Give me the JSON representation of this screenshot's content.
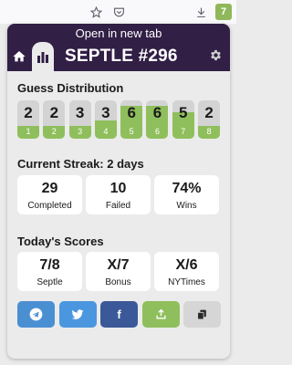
{
  "browser_toolbar": {
    "icons": [
      "star-icon",
      "pocket-icon",
      "download-icon",
      "septle-extension-icon"
    ],
    "extension_badge": "7",
    "extension_color": "#8fb85a"
  },
  "header": {
    "open_link": "Open in new tab",
    "title": "SEPTLE #296",
    "background": "#311f45"
  },
  "guess_distribution": {
    "title": "Guess Distribution",
    "bars": [
      {
        "guess": "1",
        "count": "2",
        "fill": 0.34
      },
      {
        "guess": "2",
        "count": "2",
        "fill": 0.34
      },
      {
        "guess": "3",
        "count": "3",
        "fill": 0.34
      },
      {
        "guess": "4",
        "count": "3",
        "fill": 0.48
      },
      {
        "guess": "5",
        "count": "6",
        "fill": 0.85
      },
      {
        "guess": "6",
        "count": "6",
        "fill": 0.85
      },
      {
        "guess": "7",
        "count": "5",
        "fill": 0.68
      },
      {
        "guess": "8",
        "count": "2",
        "fill": 0.34
      }
    ],
    "fill_color": "#8fbf5c",
    "empty_color": "#d3d3d3"
  },
  "streak": {
    "title": "Current Streak: 2 days",
    "stats": [
      {
        "value": "29",
        "label": "Completed"
      },
      {
        "value": "10",
        "label": "Failed"
      },
      {
        "value": "74%",
        "label": "Wins"
      }
    ]
  },
  "scores": {
    "title": "Today's Scores",
    "items": [
      {
        "value": "7/8",
        "label": "Septle"
      },
      {
        "value": "X/7",
        "label": "Bonus"
      },
      {
        "value": "X/6",
        "label": "NYTimes"
      }
    ]
  },
  "share": {
    "buttons": [
      "telegram-icon",
      "twitter-icon",
      "facebook-icon",
      "share-icon",
      "copy-icon"
    ],
    "facebook_glyph": "f"
  }
}
